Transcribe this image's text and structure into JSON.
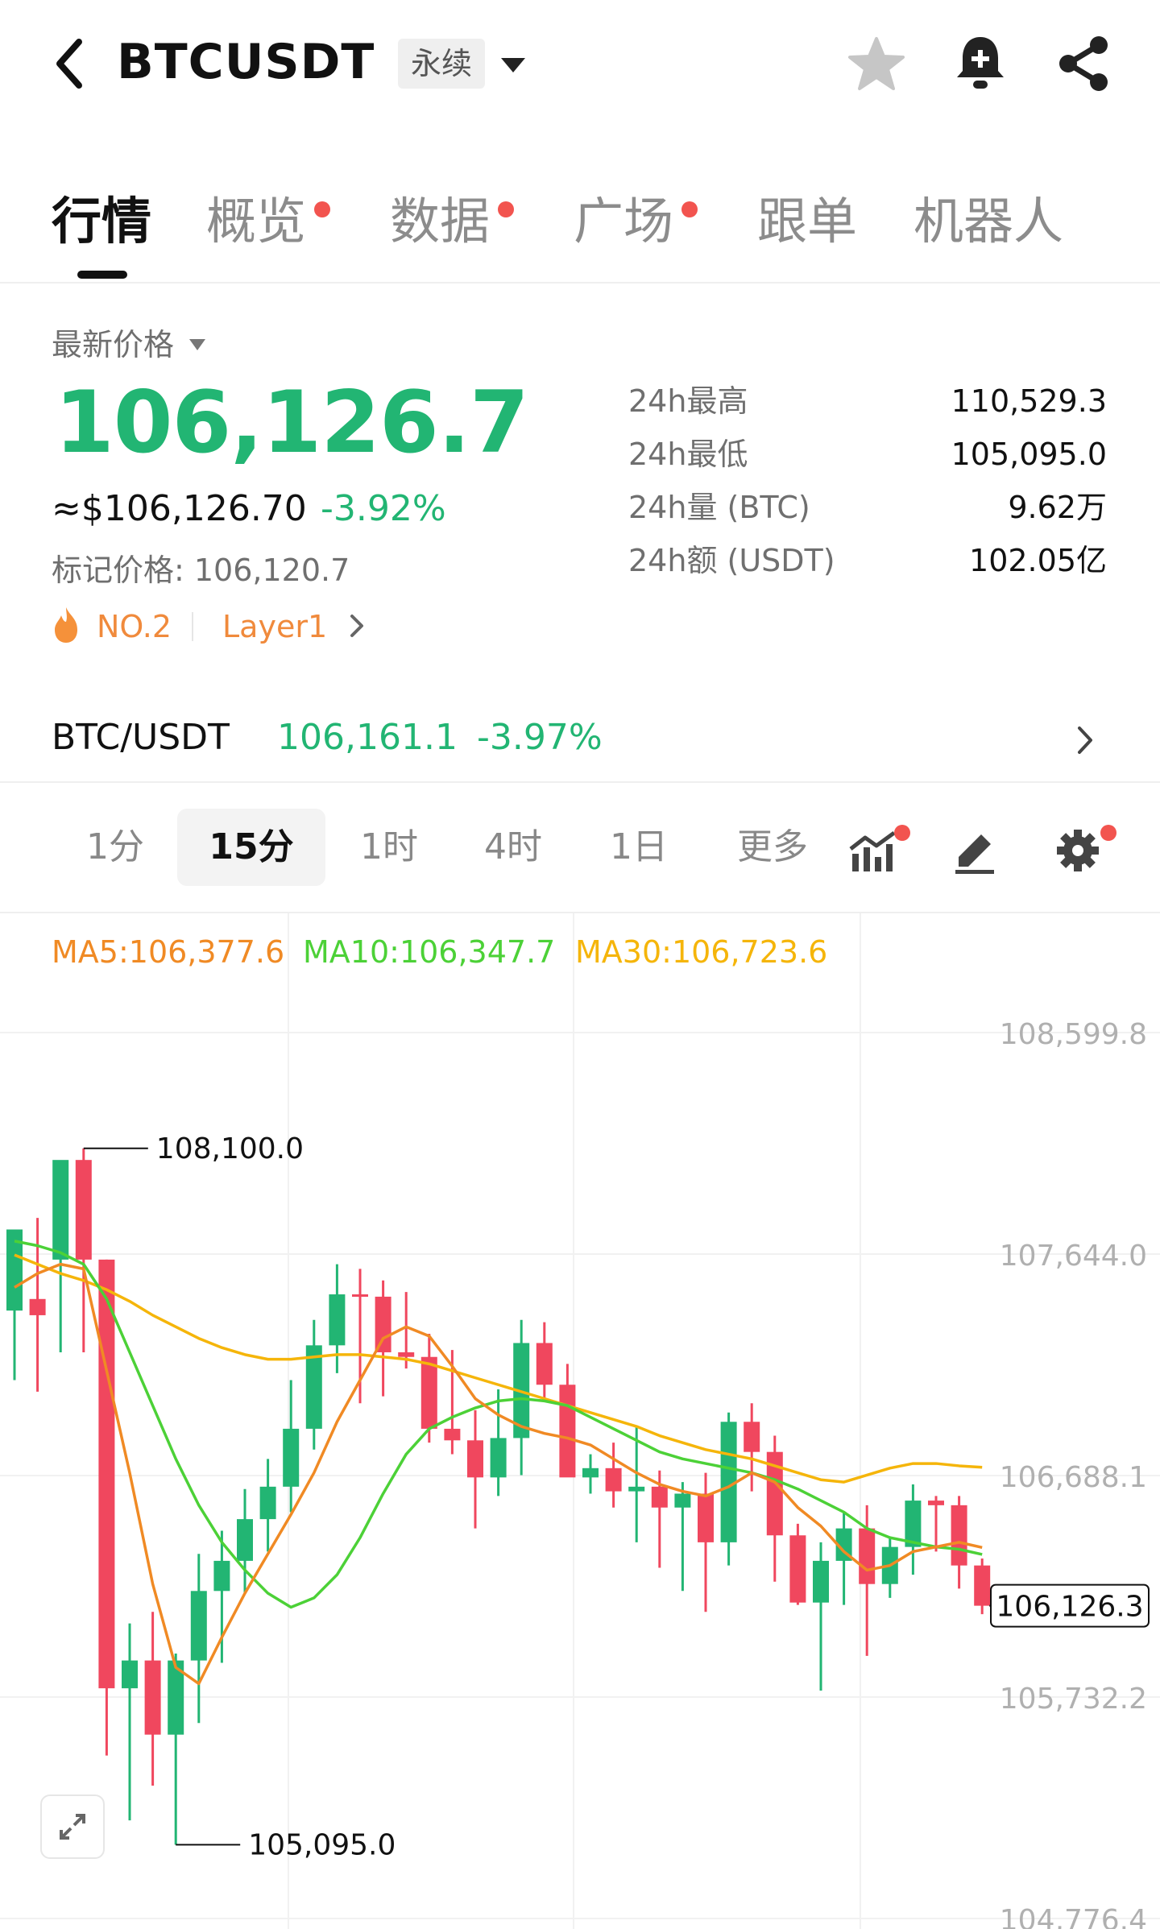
{
  "header": {
    "symbol": "BTCUSDT",
    "contract_type": "永续",
    "icons": [
      "back-icon",
      "caret-down-icon",
      "star-icon",
      "bell-plus-icon",
      "share-icon"
    ]
  },
  "tabs": [
    {
      "label": "行情",
      "active": true,
      "dot": false
    },
    {
      "label": "概览",
      "active": false,
      "dot": true
    },
    {
      "label": "数据",
      "active": false,
      "dot": true
    },
    {
      "label": "广场",
      "active": false,
      "dot": true
    },
    {
      "label": "跟单",
      "active": false,
      "dot": false
    },
    {
      "label": "机器人",
      "active": false,
      "dot": false
    }
  ],
  "price": {
    "label": "最新价格",
    "last": "106,126.7",
    "usd": "≈$106,126.70",
    "change_pct": "-3.92%",
    "mark_price_text": "标记价格: 106,120.7",
    "rank": "NO.2",
    "sector": "Layer1"
  },
  "stats": [
    {
      "label": "24h最高",
      "value": "110,529.3"
    },
    {
      "label": "24h最低",
      "value": "105,095.0"
    },
    {
      "label": "24h量 (BTC)",
      "value": "9.62万"
    },
    {
      "label": "24h额 (USDT)",
      "value": "102.05亿"
    }
  ],
  "spot": {
    "pair": "BTC/USDT",
    "price": "106,161.1",
    "change_pct": "-3.97%"
  },
  "intervals": [
    {
      "label": "1分",
      "active": false
    },
    {
      "label": "15分",
      "active": true
    },
    {
      "label": "1时",
      "active": false
    },
    {
      "label": "4时",
      "active": false
    },
    {
      "label": "1日",
      "active": false
    },
    {
      "label": "更多",
      "active": false
    }
  ],
  "toolbar_icons": [
    "indicator-icon",
    "draw-icon",
    "settings-icon"
  ],
  "colors": {
    "up": "#22b573",
    "down": "#f0475e",
    "ma5": "#f08a24",
    "ma10": "#4cd137",
    "ma30": "#f5b50a",
    "notification_dot": "#f2544f"
  },
  "chart_data": {
    "type": "candlestick",
    "interval": "15分",
    "ma_labels": {
      "ma5": "MA5:106,377.6",
      "ma10": "MA10:106,347.7",
      "ma30": "MA30:106,723.6"
    },
    "y_ticks": [
      108599.8,
      107644.0,
      106688.1,
      105732.2,
      104776.4
    ],
    "y_tick_labels": [
      "108,599.8",
      "107,644.0",
      "106,688.1",
      "105,732.2",
      "104,776.4"
    ],
    "high_marker": "108,100.0",
    "low_marker": "105,095.0",
    "current_price_label": "106,126.3",
    "candles": [
      {
        "o": 107400,
        "h": 107700,
        "l": 107100,
        "c": 107750
      },
      {
        "o": 107450,
        "h": 107800,
        "l": 107050,
        "c": 107380
      },
      {
        "o": 107620,
        "h": 108000,
        "l": 107220,
        "c": 108050
      },
      {
        "o": 108050,
        "h": 108100,
        "l": 107220,
        "c": 107620
      },
      {
        "o": 107620,
        "h": 107620,
        "l": 105480,
        "c": 105770
      },
      {
        "o": 105770,
        "h": 106050,
        "l": 105200,
        "c": 105890
      },
      {
        "o": 105890,
        "h": 106100,
        "l": 105350,
        "c": 105570
      },
      {
        "o": 105570,
        "h": 105920,
        "l": 105095,
        "c": 105890
      },
      {
        "o": 105890,
        "h": 106350,
        "l": 105620,
        "c": 106190
      },
      {
        "o": 106190,
        "h": 106450,
        "l": 105880,
        "c": 106320
      },
      {
        "o": 106320,
        "h": 106630,
        "l": 106180,
        "c": 106500
      },
      {
        "o": 106500,
        "h": 106760,
        "l": 106360,
        "c": 106640
      },
      {
        "o": 106640,
        "h": 107100,
        "l": 106530,
        "c": 106890
      },
      {
        "o": 106890,
        "h": 107360,
        "l": 106800,
        "c": 107250
      },
      {
        "o": 107250,
        "h": 107600,
        "l": 107130,
        "c": 107470
      },
      {
        "o": 107470,
        "h": 107580,
        "l": 107000,
        "c": 107460
      },
      {
        "o": 107460,
        "h": 107530,
        "l": 107030,
        "c": 107220
      },
      {
        "o": 107220,
        "h": 107480,
        "l": 107150,
        "c": 107200
      },
      {
        "o": 107200,
        "h": 107300,
        "l": 106830,
        "c": 106890
      },
      {
        "o": 106890,
        "h": 107230,
        "l": 106780,
        "c": 106840
      },
      {
        "o": 106840,
        "h": 106970,
        "l": 106460,
        "c": 106680
      },
      {
        "o": 106680,
        "h": 107060,
        "l": 106600,
        "c": 106850
      },
      {
        "o": 106850,
        "h": 107360,
        "l": 106690,
        "c": 107260
      },
      {
        "o": 107260,
        "h": 107350,
        "l": 107010,
        "c": 107080
      },
      {
        "o": 107080,
        "h": 107170,
        "l": 106780,
        "c": 106680
      },
      {
        "o": 106680,
        "h": 106780,
        "l": 106610,
        "c": 106720
      },
      {
        "o": 106720,
        "h": 106830,
        "l": 106550,
        "c": 106620
      },
      {
        "o": 106620,
        "h": 106900,
        "l": 106400,
        "c": 106640
      },
      {
        "o": 106640,
        "h": 106710,
        "l": 106290,
        "c": 106550
      },
      {
        "o": 106550,
        "h": 106660,
        "l": 106190,
        "c": 106610
      },
      {
        "o": 106610,
        "h": 106700,
        "l": 106100,
        "c": 106400
      },
      {
        "o": 106400,
        "h": 106960,
        "l": 106300,
        "c": 106920
      },
      {
        "o": 106920,
        "h": 107000,
        "l": 106620,
        "c": 106790
      },
      {
        "o": 106790,
        "h": 106860,
        "l": 106230,
        "c": 106430
      },
      {
        "o": 106430,
        "h": 106480,
        "l": 106130,
        "c": 106140
      },
      {
        "o": 106140,
        "h": 106400,
        "l": 105760,
        "c": 106320
      },
      {
        "o": 106320,
        "h": 106530,
        "l": 106130,
        "c": 106460
      },
      {
        "o": 106460,
        "h": 106560,
        "l": 105910,
        "c": 106220
      },
      {
        "o": 106220,
        "h": 106420,
        "l": 106160,
        "c": 106380
      },
      {
        "o": 106380,
        "h": 106650,
        "l": 106260,
        "c": 106580
      },
      {
        "o": 106580,
        "h": 106600,
        "l": 106360,
        "c": 106560
      },
      {
        "o": 106560,
        "h": 106600,
        "l": 106200,
        "c": 106300
      },
      {
        "o": 106300,
        "h": 106330,
        "l": 106090,
        "c": 106126.3
      }
    ],
    "ma5": [
      107500,
      107560,
      107600,
      107580,
      107140,
      106700,
      106220,
      105860,
      105790,
      105990,
      106180,
      106350,
      106520,
      106700,
      106920,
      107100,
      107280,
      107330,
      107290,
      107160,
      107020,
      106950,
      106900,
      106870,
      106850,
      106820,
      106760,
      106700,
      106650,
      106620,
      106600,
      106640,
      106700,
      106660,
      106550,
      106470,
      106360,
      106280,
      106300,
      106360,
      106380,
      106400,
      106377.6
    ],
    "ma10": [
      107700,
      107680,
      107650,
      107600,
      107450,
      107220,
      106990,
      106760,
      106560,
      106400,
      106280,
      106180,
      106120,
      106160,
      106260,
      106420,
      106610,
      106780,
      106890,
      106940,
      106980,
      107010,
      107020,
      107010,
      106990,
      106940,
      106890,
      106840,
      106790,
      106760,
      106740,
      106720,
      106700,
      106670,
      106630,
      106580,
      106530,
      106460,
      106420,
      106400,
      106380,
      106370,
      106347.7
    ],
    "ma30": [
      107640,
      107600,
      107560,
      107530,
      107490,
      107440,
      107380,
      107330,
      107280,
      107240,
      107210,
      107190,
      107190,
      107200,
      107210,
      107210,
      107200,
      107190,
      107170,
      107140,
      107110,
      107080,
      107050,
      107020,
      106990,
      106960,
      106930,
      106900,
      106860,
      106830,
      106800,
      106780,
      106760,
      106730,
      106700,
      106670,
      106660,
      106690,
      106720,
      106740,
      106740,
      106730,
      106723.6
    ]
  }
}
